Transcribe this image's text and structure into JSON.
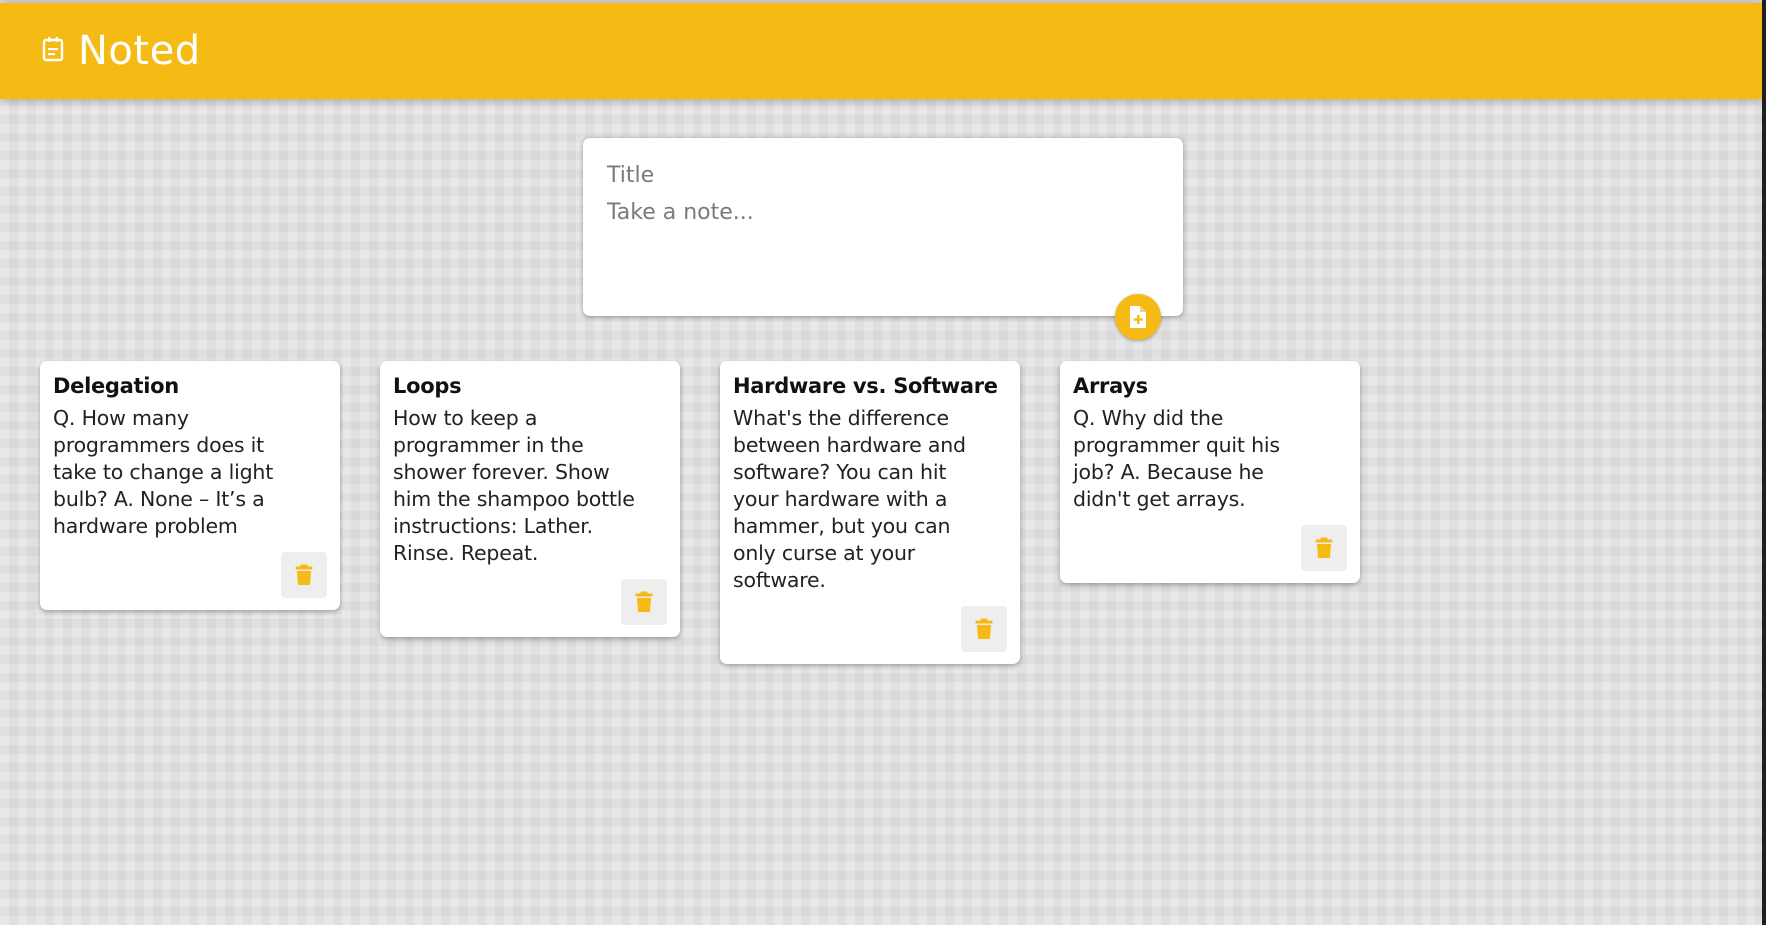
{
  "header": {
    "title": "Noted",
    "icon": "note-calendar-icon",
    "color": "#f5ba13"
  },
  "create_area": {
    "title_placeholder": "Title",
    "content_placeholder": "Take a note...",
    "add_icon": "note-add-icon"
  },
  "notes": [
    {
      "title": "Delegation",
      "content": "Q. How many\nprogrammers does it\ntake to change a light\nbulb? A. None – It’s a\nhardware problem",
      "delete_icon": "trash-icon"
    },
    {
      "title": "Loops",
      "content": "How to keep a\nprogrammer in the\nshower forever. Show\nhim the shampoo bottle\ninstructions: Lather.\nRinse. Repeat.",
      "delete_icon": "trash-icon"
    },
    {
      "title": "Hardware vs. Software",
      "content": "What's the difference\nbetween hardware and\nsoftware? You can hit\nyour hardware with a\nhammer, but you can\nonly curse at your\nsoftware.",
      "delete_icon": "trash-icon"
    },
    {
      "title": "Arrays",
      "content": "Q. Why did the\nprogrammer quit his\njob? A. Because he\ndidn't get arrays.",
      "delete_icon": "trash-icon"
    }
  ],
  "colors": {
    "accent": "#f5ba13",
    "background": "#e2e2e2",
    "card": "#ffffff"
  }
}
